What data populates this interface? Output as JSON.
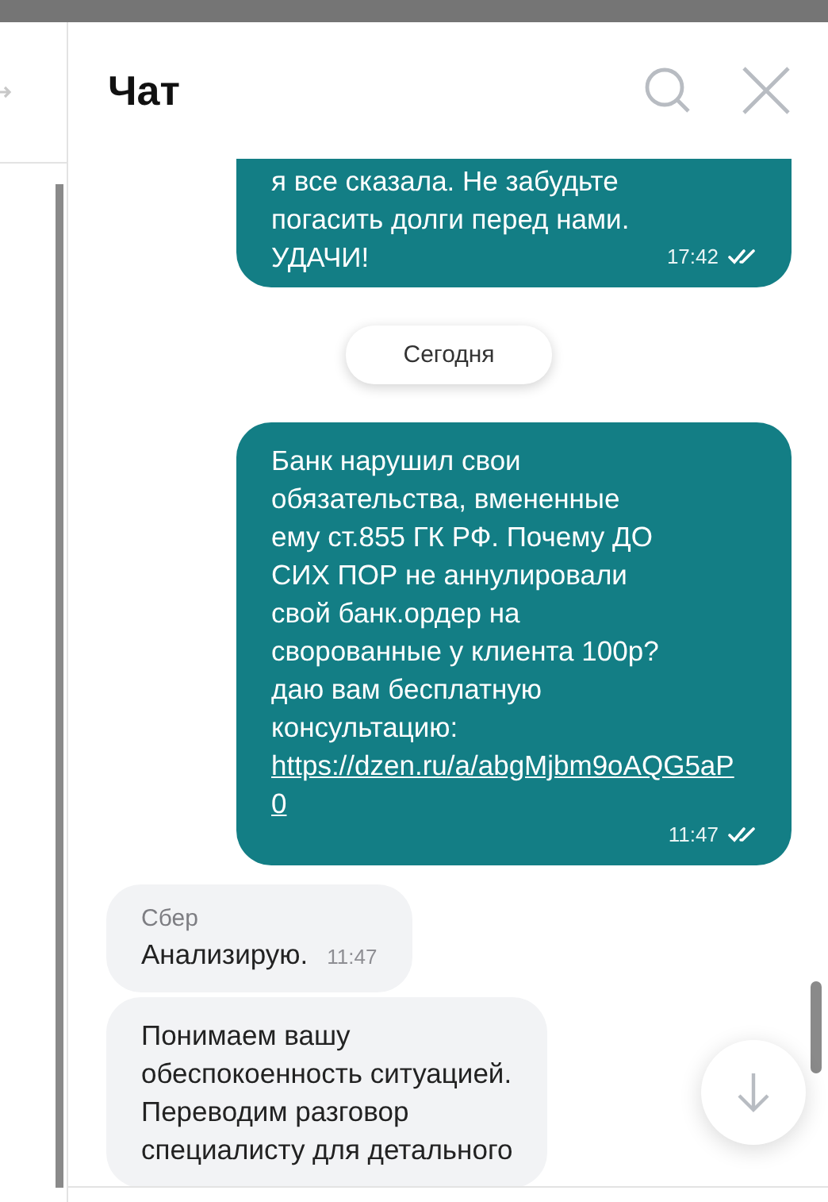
{
  "chat": {
    "title": "Чат"
  },
  "messages": [
    {
      "kind": "outgoing",
      "text": "я все сказала. Не забудьте\nпогасить долги перед нами.\nУДАЧИ!",
      "time": "17:42",
      "read": true
    },
    {
      "kind": "date",
      "text": "Сегодня"
    },
    {
      "kind": "outgoing",
      "text": "Банк нарушил свои\nобязательства, вмененные\nему ст.855 ГК РФ. Почему ДО\nСИХ ПОР не аннулировали\nсвой банк.ордер на\nсворованные у клиента 100р?\n даю вам бесплатную\nконсультацию:",
      "link": "https://dzen.ru/a/abgMjbm9oAQG5aP0",
      "time": "11:47",
      "read": true
    },
    {
      "kind": "incoming",
      "sender": "Сбер",
      "text": "Анализирую.",
      "time": "11:47"
    },
    {
      "kind": "incoming",
      "text": "Понимаем вашу\nобеспокоенность ситуацией.\nПереводим разговор\nспециалисту для детального"
    }
  ]
}
